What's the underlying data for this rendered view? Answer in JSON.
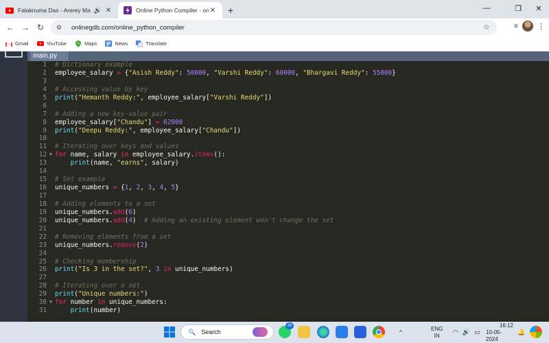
{
  "browser": {
    "tabs": [
      {
        "title": "Falaknuma Das - Arerey Ma",
        "active": false
      },
      {
        "title": "Online Python Compiler - onlin",
        "active": true
      }
    ],
    "new_tab": "+",
    "url": "onlinegdb.com/online_python_compiler",
    "bookmarks": [
      "Gmail",
      "YouTube",
      "Maps",
      "News",
      "Translate"
    ]
  },
  "editor": {
    "file_tab": "main.py",
    "lines": [
      "# Dictionary example",
      "employee_salary = {\"Asish Reddy\": 50000, \"Varshi Reddy\": 60000, \"Bhargavi Reddy\": 55000}",
      "",
      "# Accessing value by key",
      "print(\"Hemanth Reddy:\", employee_salary[\"Varshi Reddy\"])",
      "",
      "# Adding a new key-value pair",
      "employee_salary[\"Chandu\"] = 62000",
      "print(\"Deepu Reddy:\", employee_salary[\"Chandu\"])",
      "",
      "# Iterating over keys and values",
      "for name, salary in employee_salary.items():",
      "    print(name, \"earns\", salary)",
      "",
      "# Set example",
      "unique_numbers = {1, 2, 3, 4, 5}",
      "",
      "# Adding elements to a set",
      "unique_numbers.add(6)",
      "unique_numbers.add(4)  # Adding an existing element won't change the set",
      "",
      "# Removing elements from a set",
      "unique_numbers.remove(2)",
      "",
      "# Checking membership",
      "print(\"Is 3 in the set?\", 3 in unique_numbers)",
      "",
      "# Iterating over a set",
      "print(\"Unique numbers:\")",
      "for number in unique_numbers:",
      "    print(number)"
    ],
    "fold_lines": [
      12,
      30
    ]
  },
  "taskbar": {
    "search_placeholder": "Search",
    "whatsapp_badge": "26",
    "lang": "ENG",
    "region": "IN",
    "time": "16:12",
    "date": "10-05-2024"
  },
  "colors": {
    "accent": "#1a73e8",
    "editor_bg": "#272822"
  }
}
